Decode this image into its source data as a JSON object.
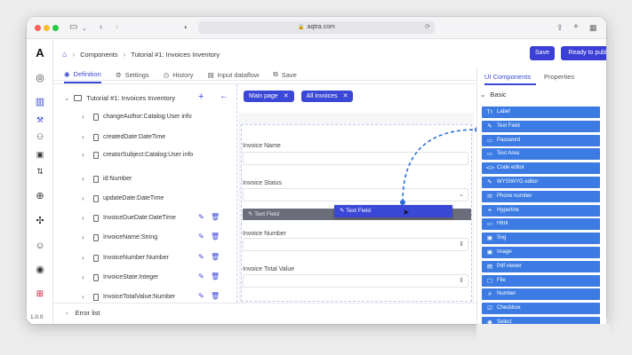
{
  "browser": {
    "url": "aqtra.com"
  },
  "app": {
    "logo": "A",
    "version": "1.0.0"
  },
  "header": {
    "breadcrumb": [
      "Components",
      "Tutorial #1: Invoices Inventory"
    ],
    "save_label": "Save",
    "publish_label": "Ready to publish"
  },
  "tabs": [
    {
      "label": "Definition",
      "icon": "eye-icon"
    },
    {
      "label": "Settings",
      "icon": "gear-icon"
    },
    {
      "label": "History",
      "icon": "history-icon"
    },
    {
      "label": "Input dataflow",
      "icon": "dataflow-icon"
    },
    {
      "label": "Save",
      "icon": "save-icon"
    }
  ],
  "tree": {
    "root": "Tutorial #1: Invoices Inventory",
    "items": [
      "changeAuthor:Catalog:User info",
      "createdDate:DateTime",
      "creatorSubject:Catalog:User info",
      "id:Number",
      "updateDate:DateTime",
      "InvoiceDueDate:DateTime",
      "InvoiceName:String",
      "InvoiceNumber:Number",
      "InvoiceState:Integer",
      "InvoiceTotalValue:Number"
    ]
  },
  "error_list": "Error list",
  "canvas": {
    "chips": [
      "Main page",
      "All invoices"
    ],
    "fields": {
      "invoice_name": "Invoice Name",
      "invoice_status": "Invoice Status",
      "invoice_number": "Invoice Number",
      "invoice_total": "Invoice Total Value"
    },
    "drop_zone": "Text Field",
    "drag_item": "Text Field"
  },
  "right_panel": {
    "tab_components": "UI Components",
    "tab_properties": "Properties",
    "section": "Basic",
    "components": [
      {
        "label": "Label",
        "icon": "Tт"
      },
      {
        "label": "Text Field",
        "icon": "✎"
      },
      {
        "label": "Password",
        "icon": "▭"
      },
      {
        "label": "Text Area",
        "icon": "▭"
      },
      {
        "label": "Code editor",
        "icon": "</>"
      },
      {
        "label": "WYSIWYG editor",
        "icon": "✎"
      },
      {
        "label": "Phone number",
        "icon": "☏"
      },
      {
        "label": "Hyperlink",
        "icon": "⚭"
      },
      {
        "label": "Html",
        "icon": "▭"
      },
      {
        "label": "Svg",
        "icon": "▣"
      },
      {
        "label": "Image",
        "icon": "▣"
      },
      {
        "label": "Pdf viewer",
        "icon": "▤"
      },
      {
        "label": "File",
        "icon": "▢"
      },
      {
        "label": "Number",
        "icon": "#"
      },
      {
        "label": "Checkbox",
        "icon": "☑"
      },
      {
        "label": "Select",
        "icon": "◉"
      }
    ]
  }
}
